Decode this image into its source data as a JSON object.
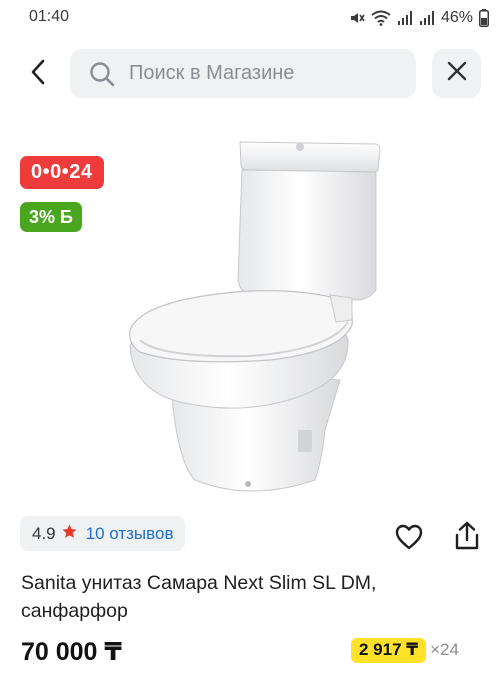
{
  "status_bar": {
    "time": "01:40",
    "battery_percent": "46%",
    "icons": [
      "mute-icon",
      "wifi-icon",
      "signal-icon",
      "signal-icon",
      "battery-icon"
    ]
  },
  "search": {
    "placeholder": "Поиск в Магазине"
  },
  "product": {
    "installment_badge": "0•0•24",
    "bonus_badge": "3% Б",
    "rating": "4.9",
    "reviews": "10 отзывов",
    "title": "Sanita унитаз Самара Next Slim SL DM, санфарфор",
    "price": "70 000 ₸",
    "monthly_payment": "2 917 ₸",
    "months": "×24"
  },
  "colors": {
    "installment_badge": "#ee3b3b",
    "bonus_badge": "#4aa61f",
    "monthly_badge": "#ffe12a",
    "link": "#1c6fd1",
    "star": "#e8372b"
  }
}
